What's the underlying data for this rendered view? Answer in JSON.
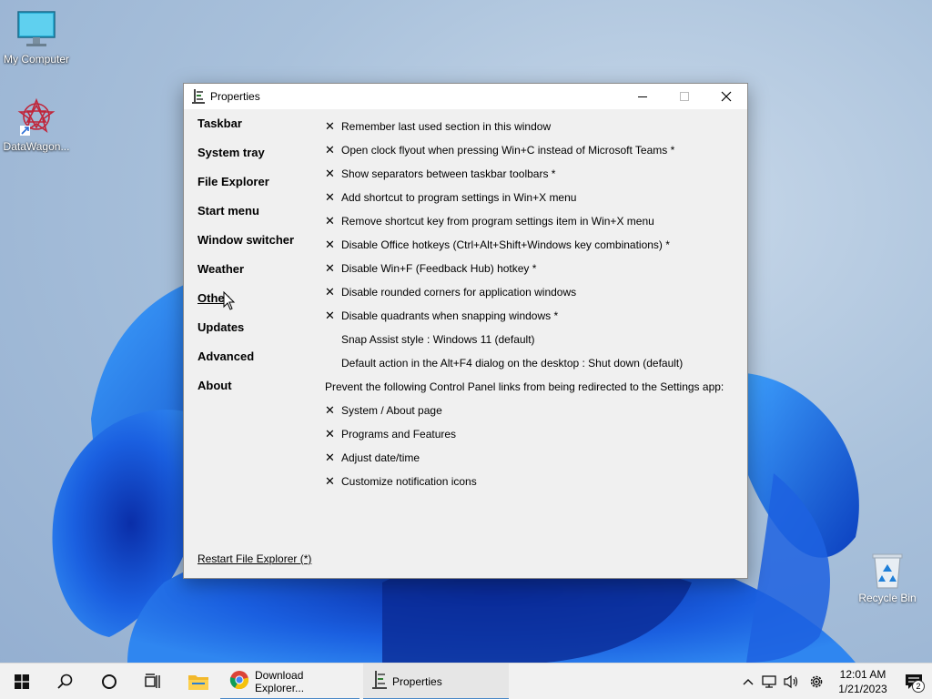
{
  "desktop": {
    "icons": [
      {
        "label": "My Computer",
        "icon": "monitor-icon"
      },
      {
        "label": "DataWagon...",
        "icon": "datawagon-icon"
      }
    ],
    "recycle_bin": {
      "label": "Recycle Bin",
      "icon": "recycle-bin-icon"
    }
  },
  "window": {
    "title": "Properties",
    "nav": [
      "Taskbar",
      "System tray",
      "File Explorer",
      "Start menu",
      "Window switcher",
      "Weather",
      "Other",
      "Updates",
      "Advanced",
      "About"
    ],
    "active_nav": "Other",
    "options": [
      {
        "checked": true,
        "label": "Remember last used section in this window"
      },
      {
        "checked": true,
        "label": "Open clock flyout when pressing Win+C instead of Microsoft Teams *"
      },
      {
        "checked": true,
        "label": "Show separators between taskbar toolbars *"
      },
      {
        "checked": true,
        "label": "Add shortcut to program settings in Win+X menu"
      },
      {
        "checked": true,
        "label": "Remove shortcut key from program settings item in Win+X menu"
      },
      {
        "checked": true,
        "label": "Disable Office hotkeys (Ctrl+Alt+Shift+Windows key combinations) *"
      },
      {
        "checked": true,
        "label": "Disable Win+F (Feedback Hub) hotkey *"
      },
      {
        "checked": true,
        "label": "Disable rounded corners for application windows"
      },
      {
        "checked": true,
        "label": "Disable quadrants when snapping windows *"
      },
      {
        "checked": false,
        "label": "Snap Assist style : Windows 11 (default)"
      },
      {
        "checked": false,
        "label": "Default action in the Alt+F4 dialog on the desktop : Shut down (default)"
      }
    ],
    "section_heading": "Prevent the following Control Panel links from being redirected to the Settings app:",
    "cpl_options": [
      {
        "checked": true,
        "label": "System / About page"
      },
      {
        "checked": true,
        "label": "Programs and Features"
      },
      {
        "checked": true,
        "label": "Adjust date/time"
      },
      {
        "checked": true,
        "label": "Customize notification icons"
      }
    ],
    "restart_link": "Restart File Explorer (*)"
  },
  "taskbar": {
    "apps": [
      {
        "label": "Download Explorer...",
        "icon": "chrome-icon"
      },
      {
        "label": "Properties",
        "icon": "properties-icon"
      }
    ],
    "clock": {
      "time": "12:01 AM",
      "date": "1/21/2023"
    },
    "notification_count": "2"
  }
}
